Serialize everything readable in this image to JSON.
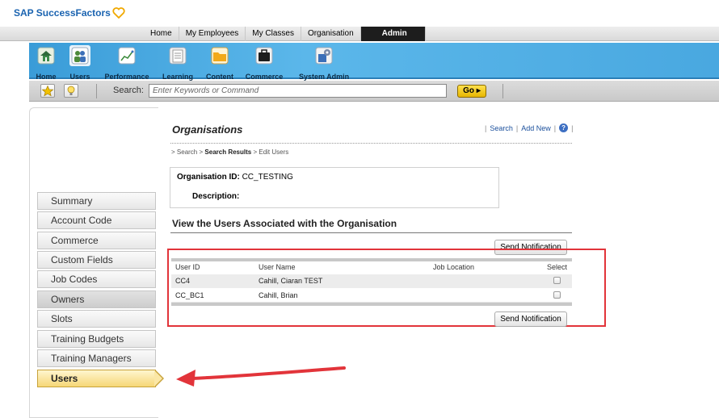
{
  "brand": {
    "name": "SAP SuccessFactors"
  },
  "global_nav": {
    "tabs": [
      {
        "label": "Home"
      },
      {
        "label": "My Employees"
      },
      {
        "label": "My Classes"
      },
      {
        "label": "Organisation"
      },
      {
        "label": "Admin",
        "active": true
      }
    ]
  },
  "modules": [
    {
      "label": "Home",
      "icon": "home-icon"
    },
    {
      "label": "Users",
      "icon": "users-icon",
      "active": true
    },
    {
      "label": "Performance",
      "icon": "performance-chart-icon"
    },
    {
      "label": "Learning",
      "icon": "learning-document-icon"
    },
    {
      "label": "Content",
      "icon": "content-folder-icon"
    },
    {
      "label": "Commerce",
      "icon": "briefcase-icon"
    },
    {
      "label": "System Admin",
      "icon": "system-admin-icon"
    }
  ],
  "search": {
    "label": "Search:",
    "placeholder": "Enter Keywords or Command",
    "go_label": "Go"
  },
  "sidebar": {
    "items": [
      {
        "label": "Summary"
      },
      {
        "label": "Account Code"
      },
      {
        "label": "Commerce"
      },
      {
        "label": "Custom Fields"
      },
      {
        "label": "Job Codes"
      },
      {
        "label": "Owners"
      },
      {
        "label": "Slots"
      },
      {
        "label": "Training Budgets"
      },
      {
        "label": "Training Managers"
      },
      {
        "label": "Users",
        "active": true
      }
    ]
  },
  "page": {
    "title": "Organisations",
    "links": {
      "search": "Search",
      "add_new": "Add New"
    },
    "breadcrumb": {
      "search": "Search",
      "results": "Search Results",
      "current": "Edit Users",
      "sep": ">"
    },
    "org": {
      "id_label": "Organisation ID:",
      "id_value": "CC_TESTING",
      "desc_label": "Description:"
    },
    "section_title": "View the Users Associated with the Organisation",
    "send_notification": "Send Notification",
    "table": {
      "columns": [
        "User ID",
        "User Name",
        "Job Location",
        "Select"
      ],
      "rows": [
        {
          "user_id": "CC4",
          "user_name": "Cahill, Ciaran TEST",
          "job_location": ""
        },
        {
          "user_id": "CC_BC1",
          "user_name": "Cahill, Brian",
          "job_location": ""
        }
      ]
    }
  },
  "colors": {
    "accent": "#1a63b0",
    "annotation": "#e2343a",
    "go": "#f5c400"
  }
}
